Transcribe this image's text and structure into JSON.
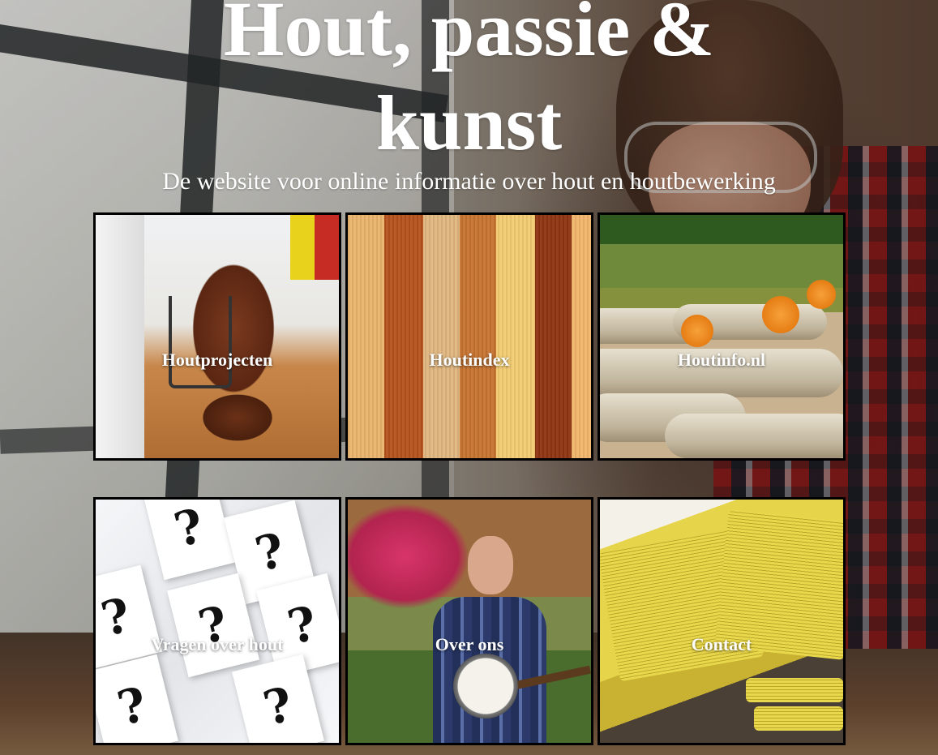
{
  "header": {
    "title": "Hout, passie & kunst",
    "subtitle": "De website voor online informatie over hout en houtbewerking"
  },
  "tiles": [
    {
      "label": "Houtprojecten",
      "icon": "wood-carving-image"
    },
    {
      "label": "Houtindex",
      "icon": "wood-strips-image"
    },
    {
      "label": "Houtinfo.nl",
      "icon": "logs-image"
    },
    {
      "label": "Vragen over hout",
      "icon": "question-marks-image"
    },
    {
      "label": "Over ons",
      "icon": "person-banjo-image"
    },
    {
      "label": "Contact",
      "icon": "phone-book-image"
    }
  ],
  "colors": {
    "text": "#ffffff",
    "tile_border": "#000000"
  }
}
